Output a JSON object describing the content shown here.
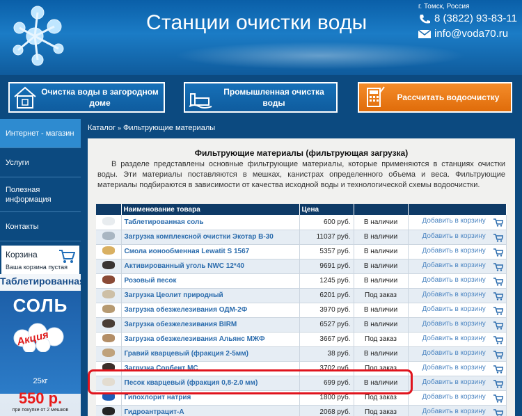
{
  "header": {
    "title": "Станции очистки воды",
    "city": "г. Томск, Россия",
    "phone": "8 (3822) 93-83-11",
    "email": "info@voda70.ru"
  },
  "nav": [
    {
      "label": "Очистка воды в загородном доме",
      "icon": "house-icon"
    },
    {
      "label": "Промышленная очистка воды",
      "icon": "factory-icon"
    },
    {
      "label": "Рассчитать водоочистку",
      "icon": "calculator-icon"
    }
  ],
  "sidebar": {
    "items": [
      {
        "label": "Интернет - магазин"
      },
      {
        "label": "Услуги"
      },
      {
        "label": "Полезная информация"
      },
      {
        "label": "Контакты"
      }
    ],
    "cart": {
      "title": "Корзина",
      "status": "Ваша корзина пустая"
    },
    "promo": {
      "title": "Таблетированная",
      "product": "СОЛЬ",
      "badge": "Акция",
      "weight": "25кг",
      "price": "550 р.",
      "note": "при покупке от 2 мешков"
    }
  },
  "breadcrumb": {
    "root": "Каталог",
    "separator": "»",
    "current": "Фильтрующие материалы"
  },
  "page": {
    "title": "Фильтрующие материалы (фильтрующая загрузка)",
    "intro": "В разделе представлены основные фильтрующие материалы, которые применяются в станциях очистки воды. Эти материалы поставляются в мешках, канистрах определенного объема и веса. Фильтрующие материалы подбираются в зависимости от качества исходной воды и технологической схемы водоочистки."
  },
  "table": {
    "headers": [
      "",
      "Наименование товара",
      "Цена",
      "",
      ""
    ],
    "add_label": "Добавить в корзину",
    "rows": [
      {
        "name": "Таблетированная соль",
        "price": "600 руб.",
        "availability": "В наличии",
        "thumb": "#e8ecef"
      },
      {
        "name": "Загрузка комплексной очистки Экотар В-30",
        "price": "11037 руб.",
        "availability": "В наличии",
        "thumb": "#a9b6c2"
      },
      {
        "name": "Смола ионообменная Lewatit S 1567",
        "price": "5357 руб.",
        "availability": "В наличии",
        "thumb": "#d9b062"
      },
      {
        "name": "Активированный уголь NWC 12*40",
        "price": "9691 руб.",
        "availability": "В наличии",
        "thumb": "#3a3533"
      },
      {
        "name": "Розовый песок",
        "price": "1245 руб.",
        "availability": "В наличии",
        "thumb": "#8a4a36"
      },
      {
        "name": "Загрузка Цеолит природный",
        "price": "6201 руб.",
        "availability": "Под заказ",
        "thumb": "#cdbfa6"
      },
      {
        "name": "Загрузка обезжелезивания ОДМ-2Ф",
        "price": "3970 руб.",
        "availability": "В наличии",
        "thumb": "#b69a72"
      },
      {
        "name": "Загрузка обезжелезивания BIRM",
        "price": "6527 руб.",
        "availability": "В наличии",
        "thumb": "#4a3e36"
      },
      {
        "name": "Загрузка обезжелезивания Альянс МЖФ",
        "price": "3667 руб.",
        "availability": "Под заказ",
        "thumb": "#b38e67"
      },
      {
        "name": "Гравий кварцевый (фракция 2-5мм)",
        "price": "38 руб.",
        "availability": "В наличии",
        "thumb": "#bfa27c"
      },
      {
        "name": "Загрузка Сорбент МС",
        "price": "3702 руб.",
        "availability": "Под заказ",
        "thumb": "#3b2f2a"
      },
      {
        "name": "Песок кварцевый (фракция 0,8-2.0 мм)",
        "price": "699 руб.",
        "availability": "В наличии",
        "thumb": "#e3dcd0"
      },
      {
        "name": "Гипохлорит натрия",
        "price": "1800 руб.",
        "availability": "Под заказ",
        "thumb": "#1c5db8"
      },
      {
        "name": "Гидроантрацит-А",
        "price": "2068 руб.",
        "availability": "Под заказ",
        "thumb": "#242424"
      }
    ]
  },
  "colors": {
    "header_blue": "#1b7cc6",
    "nav_orange": "#f48c2a",
    "table_header": "#0e3a66",
    "highlight": "#e0141d"
  }
}
